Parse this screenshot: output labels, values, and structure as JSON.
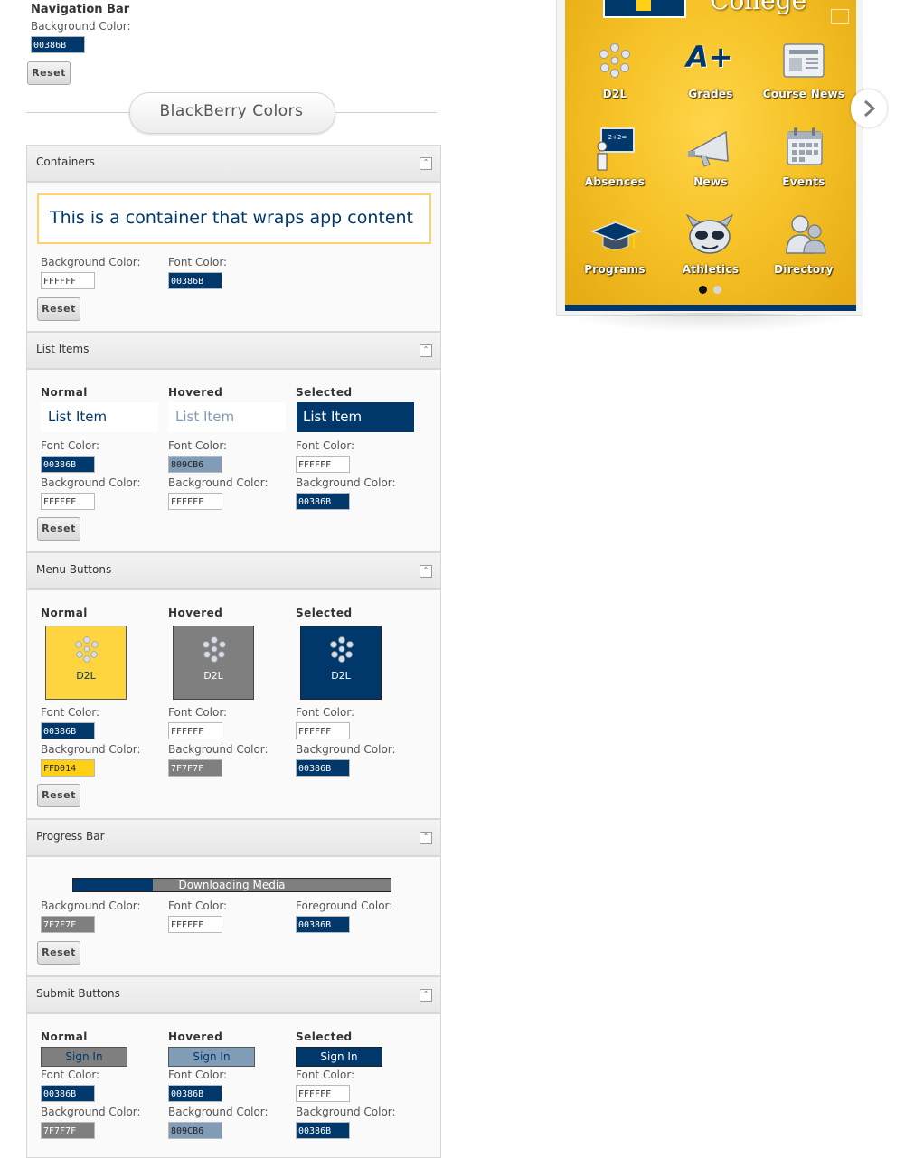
{
  "nav_bar": {
    "title": "Navigation Bar",
    "bg_label": "Background Color:",
    "bg_value": "00386B",
    "reset": "Reset"
  },
  "section_title": "BlackBerry Colors",
  "containers": {
    "title": "Containers",
    "sample_text": "This is a container that wraps app content",
    "bg_label": "Background Color:",
    "bg_value": "FFFFFF",
    "font_label": "Font Color:",
    "font_value": "00386B",
    "reset": "Reset"
  },
  "list_items": {
    "title": "List Items",
    "columns": [
      {
        "head": "Normal",
        "sample": "List Item",
        "font_label": "Font Color:",
        "font_value": "00386B",
        "bg_label": "Background Color:",
        "bg_value": "FFFFFF"
      },
      {
        "head": "Hovered",
        "sample": "List Item",
        "font_label": "Font Color:",
        "font_value": "809CB6",
        "bg_label": "Background Color:",
        "bg_value": "FFFFFF"
      },
      {
        "head": "Selected",
        "sample": "List Item",
        "font_label": "Font Color:",
        "font_value": "FFFFFF",
        "bg_label": "Background Color:",
        "bg_value": "00386B"
      }
    ],
    "reset": "Reset"
  },
  "menu_buttons": {
    "title": "Menu Buttons",
    "columns": [
      {
        "head": "Normal",
        "sample": "D2L",
        "font_label": "Font Color:",
        "font_value": "00386B",
        "bg_label": "Background Color:",
        "bg_value": "FFD014"
      },
      {
        "head": "Hovered",
        "sample": "D2L",
        "font_label": "Font Color:",
        "font_value": "FFFFFF",
        "bg_label": "Background Color:",
        "bg_value": "7F7F7F"
      },
      {
        "head": "Selected",
        "sample": "D2L",
        "font_label": "Font Color:",
        "font_value": "FFFFFF",
        "bg_label": "Background Color:",
        "bg_value": "00386B"
      }
    ],
    "reset": "Reset"
  },
  "progress_bar": {
    "title": "Progress Bar",
    "text": "Downloading Media",
    "progress": 0.25,
    "bg_label": "Background Color:",
    "bg_value": "7F7F7F",
    "font_label": "Font Color:",
    "font_value": "FFFFFF",
    "fg_label": "Foreground Color:",
    "fg_value": "00386B",
    "reset": "Reset"
  },
  "submit_buttons": {
    "title": "Submit Buttons",
    "columns": [
      {
        "head": "Normal",
        "sample": "Sign In",
        "font_label": "Font Color:",
        "font_value": "00386B",
        "bg_label": "Background Color:",
        "bg_value": "7F7F7F"
      },
      {
        "head": "Hovered",
        "sample": "Sign In",
        "font_label": "Font Color:",
        "font_value": "00386B",
        "bg_label": "Background Color:",
        "bg_value": "809CB6"
      },
      {
        "head": "Selected",
        "sample": "Sign In",
        "font_label": "Font Color:",
        "font_value": "FFFFFF",
        "bg_label": "Background Color:",
        "bg_value": "00386B"
      }
    ]
  },
  "phone_preview": {
    "header_text": "College",
    "icons": [
      {
        "label": "D2L",
        "icon": "d2l-icon"
      },
      {
        "label": "Grades",
        "icon": "grades-icon"
      },
      {
        "label": "Course News",
        "icon": "course-news-icon"
      },
      {
        "label": "Absences",
        "icon": "absences-icon"
      },
      {
        "label": "News",
        "icon": "megaphone-icon"
      },
      {
        "label": "Events",
        "icon": "calendar-icon"
      },
      {
        "label": "Programs",
        "icon": "graduation-cap-icon"
      },
      {
        "label": "Athletics",
        "icon": "mascot-icon"
      },
      {
        "label": "Directory",
        "icon": "directory-icon"
      }
    ],
    "grades_glyph": "A+",
    "page_count": 2,
    "active_page": 0
  },
  "colors": {
    "navy": "#00386B",
    "gold": "#FFD014",
    "gray": "#7F7F7F",
    "light_blue": "#809CB6",
    "white": "#FFFFFF"
  }
}
